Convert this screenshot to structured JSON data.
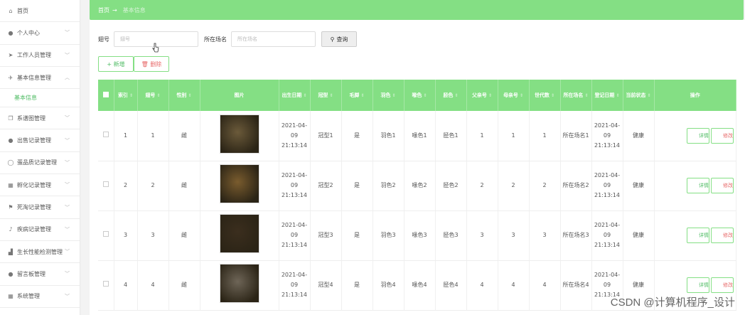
{
  "sidebar": {
    "items": [
      {
        "label": "首页",
        "icon": "home-icon",
        "glyph": "⌂",
        "chevron": false
      },
      {
        "label": "个人中心",
        "icon": "user-icon",
        "glyph": "●",
        "chevron": true
      },
      {
        "label": "工作人员管理",
        "icon": "send-icon",
        "glyph": "➤",
        "chevron": true
      },
      {
        "label": "基本信息管理",
        "icon": "nav-icon",
        "glyph": "✈",
        "chevron": true,
        "expanded": true
      }
    ],
    "active_sub": "基本信息",
    "items2": [
      {
        "label": "系谱图管理",
        "icon": "copy-icon",
        "glyph": "❐",
        "chevron": true
      },
      {
        "label": "出售记录管理",
        "icon": "user-icon",
        "glyph": "●",
        "chevron": true
      },
      {
        "label": "蛋品质记录管理",
        "icon": "power-icon",
        "glyph": "◯",
        "chevron": true
      },
      {
        "label": "孵化记录管理",
        "icon": "grid-icon",
        "glyph": "▦",
        "chevron": true
      },
      {
        "label": "死淘记录管理",
        "icon": "flag-icon",
        "glyph": "⚑",
        "chevron": true
      },
      {
        "label": "疾病记录管理",
        "icon": "mic-icon",
        "glyph": "♪",
        "chevron": true
      },
      {
        "label": "生长性能检测管理",
        "icon": "chart-icon",
        "glyph": "▟",
        "chevron": true
      },
      {
        "label": "留言板管理",
        "icon": "user-icon",
        "glyph": "●",
        "chevron": true
      },
      {
        "label": "系统管理",
        "icon": "grid-icon",
        "glyph": "▦",
        "chevron": true
      }
    ]
  },
  "breadcrumb": {
    "home": "首页",
    "sep": "→",
    "current": "基本信息"
  },
  "search": {
    "field1_label": "翅号",
    "field1_placeholder": "翅号",
    "field2_label": "所在场名",
    "field2_placeholder": "所在场名",
    "button_label": "查询"
  },
  "actions": {
    "add_label": "新增",
    "delete_label": "删除"
  },
  "table": {
    "headers": [
      "索引",
      "翅号",
      "性别",
      "图片",
      "出生日期",
      "冠型",
      "毛脚",
      "羽色",
      "喙色",
      "胫色",
      "父亲号",
      "母亲号",
      "世代数",
      "所在场名",
      "登记日期",
      "当前状态",
      "操作"
    ],
    "detail_label": "详情",
    "edit_label": "修改",
    "rows": [
      {
        "index": "1",
        "wing": "1",
        "sex": "雌",
        "img_color": "#6b5a3a",
        "birth": "2021-04-09 21:13:14",
        "crest": "冠型1",
        "feet": "是",
        "plumage": "羽色1",
        "beak": "喙色1",
        "shank": "胫色1",
        "father": "1",
        "mother": "1",
        "gen": "1",
        "farm": "所在场名1",
        "reg": "2021-04-09 21:13:14",
        "status": "健康"
      },
      {
        "index": "2",
        "wing": "2",
        "sex": "雌",
        "img_color": "#7a5c2e",
        "birth": "2021-04-09 21:13:14",
        "crest": "冠型2",
        "feet": "是",
        "plumage": "羽色2",
        "beak": "喙色2",
        "shank": "胫色2",
        "father": "2",
        "mother": "2",
        "gen": "2",
        "farm": "所在场名2",
        "reg": "2021-04-09 21:13:14",
        "status": "健康"
      },
      {
        "index": "3",
        "wing": "3",
        "sex": "雌",
        "img_color": "#3b2e1e",
        "birth": "2021-04-09 21:13:14",
        "crest": "冠型3",
        "feet": "是",
        "plumage": "羽色3",
        "beak": "喙色3",
        "shank": "胫色3",
        "father": "3",
        "mother": "3",
        "gen": "3",
        "farm": "所在场名3",
        "reg": "2021-04-09 21:13:14",
        "status": "健康"
      },
      {
        "index": "4",
        "wing": "4",
        "sex": "雌",
        "img_color": "#6e6557",
        "birth": "2021-04-09 21:13:14",
        "crest": "冠型4",
        "feet": "是",
        "plumage": "羽色4",
        "beak": "喙色4",
        "shank": "胫色4",
        "father": "4",
        "mother": "4",
        "gen": "4",
        "farm": "所在场名4",
        "reg": "2021-04-09 21:13:14",
        "status": "健康"
      }
    ]
  },
  "watermark": "CSDN @计算机程序_设计",
  "colors": {
    "accent": "#84df84",
    "accent_text": "#4dbb62",
    "danger": "#e76a6a"
  }
}
